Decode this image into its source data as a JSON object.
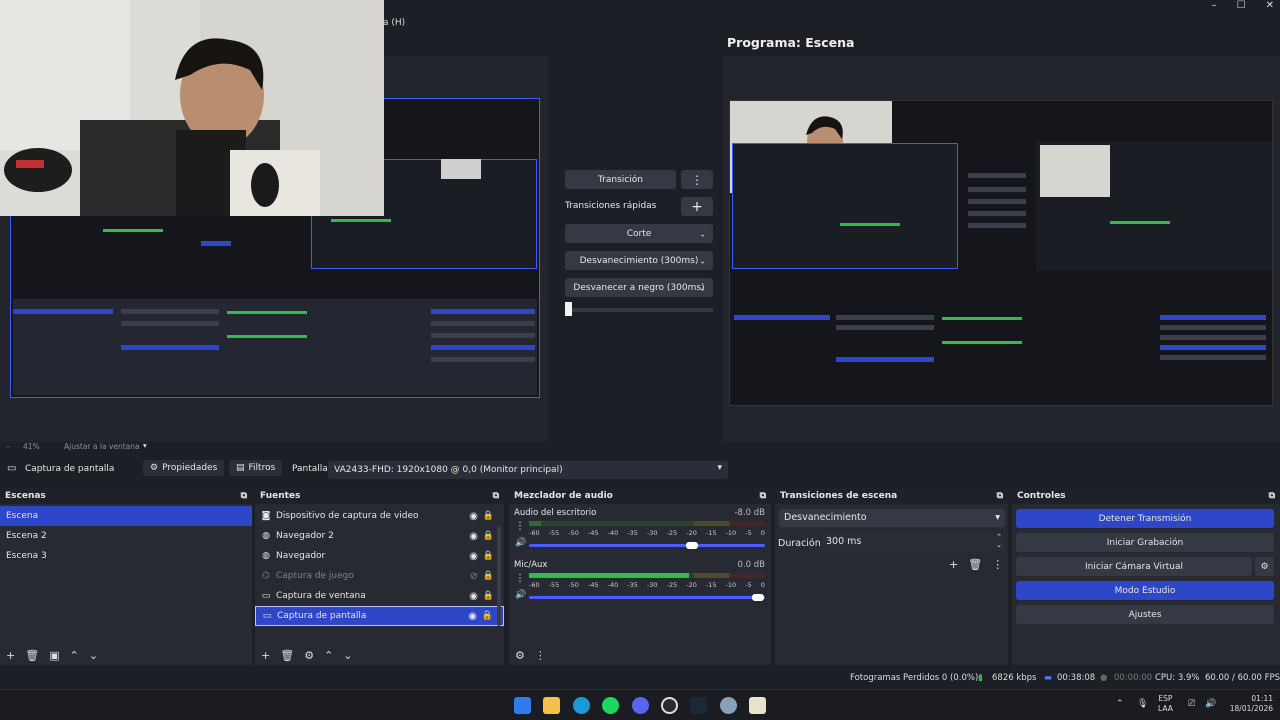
{
  "window": {
    "menu_partial": "a (H)",
    "minimize": "–",
    "maximize": "☐",
    "close": "✕"
  },
  "program": {
    "title": "Programa: Escena"
  },
  "transition_panel": {
    "transition_btn": "Transición",
    "quick_label": "Transiciones rápidas",
    "items": [
      "Corte",
      "Desvanecimiento (300ms)",
      "Desvanecer a negro (300ms)"
    ]
  },
  "zoom": {
    "percent": "41%",
    "fit": "Ajustar a la ventana",
    "sep": "–"
  },
  "context": {
    "source": "Captura de pantalla",
    "props": "Propiedades",
    "filters": "Filtros",
    "screen_label": "Pantalla",
    "screen_value": "VA2433-FHD: 1920x1080 @ 0,0 (Monitor principal)"
  },
  "scenes": {
    "title": "Escenas",
    "items": [
      "Escena",
      "Escena 2",
      "Escena 3"
    ]
  },
  "sources": {
    "title": "Fuentes",
    "items": [
      "Dispositivo de captura de video",
      "Navegador 2",
      "Navegador",
      "Captura de juego",
      "Captura de ventana",
      "Captura de pantalla"
    ]
  },
  "mixer": {
    "title": "Mezclador de audio",
    "channels": [
      {
        "name": "Audio del escritorio",
        "db": "-8.0 dB",
        "level": 0.05,
        "volume": 0.69
      },
      {
        "name": "Mic/Aux",
        "db": "0.0 dB",
        "level": 0.68,
        "volume": 0.97
      }
    ],
    "scale": [
      "-60",
      "-55",
      "-50",
      "-45",
      "-40",
      "-35",
      "-30",
      "-25",
      "-20",
      "-15",
      "-10",
      "-5",
      "0"
    ]
  },
  "transitions": {
    "title": "Transiciones de escena",
    "selected": "Desvanecimiento",
    "duration_label": "Duración",
    "duration": "300 ms"
  },
  "controls": {
    "title": "Controles",
    "stop_stream": "Detener Transmisión",
    "start_rec": "Iniciar Grabación",
    "virtual_cam": "Iniciar Cámara Virtual",
    "studio": "Modo Estudio",
    "settings": "Ajustes"
  },
  "status": {
    "dropped": "Fotogramas Perdidos 0 (0.0%)",
    "bitrate": "6826 kbps",
    "stream_time": "00:38:08",
    "rec_time": "00:00:00",
    "cpu": "CPU: 3.9%",
    "fps": "60.00 / 60.00 FPS"
  },
  "taskbar": {
    "lang1": "ESP",
    "lang2": "LAA",
    "time": "01:11",
    "date": "18/01/2026"
  },
  "colors": {
    "accent": "#2e47c8",
    "bg": "#1d1f26",
    "panel": "#272a33"
  }
}
